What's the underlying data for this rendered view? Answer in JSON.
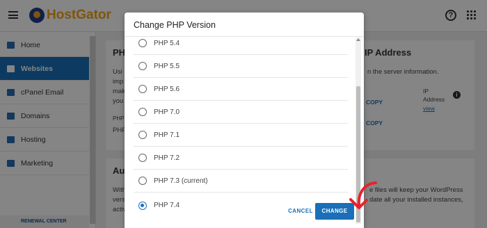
{
  "topbar": {
    "brand": "HostGator"
  },
  "sidebar": {
    "items": [
      {
        "label": "Home"
      },
      {
        "label": "Websites"
      },
      {
        "label": "cPanel Email"
      },
      {
        "label": "Domains"
      },
      {
        "label": "Hosting"
      },
      {
        "label": "Marketing"
      }
    ],
    "renewal": "RENEWAL CENTER"
  },
  "background": {
    "php_card": {
      "title_fragment": "PH",
      "lines": [
        "Usi",
        "imp",
        "mak",
        "you"
      ],
      "row1": "PHP",
      "row2": "PHP"
    },
    "ip_card": {
      "title": "IP Address",
      "text": "n the server information.",
      "copy1": "COPY",
      "copy2": "COPY",
      "ip_label_line1": "IP",
      "ip_label_line2": "Address",
      "view_link": "view"
    },
    "auto_card": {
      "title_fragment": "Aut",
      "left_lines": [
        "With",
        "vers",
        "activ"
      ],
      "right_lines": [
        "e files will keep your WordPress",
        "date all your installed instances,"
      ]
    }
  },
  "modal": {
    "title": "Change PHP Version",
    "options": [
      {
        "label": "PHP 5.4",
        "selected": false
      },
      {
        "label": "PHP 5.5",
        "selected": false
      },
      {
        "label": "PHP 5.6",
        "selected": false
      },
      {
        "label": "PHP 7.0",
        "selected": false
      },
      {
        "label": "PHP 7.1",
        "selected": false
      },
      {
        "label": "PHP 7.2",
        "selected": false
      },
      {
        "label": "PHP 7.3 (current)",
        "selected": false
      },
      {
        "label": "PHP 7.4",
        "selected": true
      }
    ],
    "cancel_label": "CANCEL",
    "change_label": "CHANGE"
  },
  "colors": {
    "accent": "#1a6fb8",
    "brand": "#f3a31a",
    "annotation": "#e8222b"
  }
}
